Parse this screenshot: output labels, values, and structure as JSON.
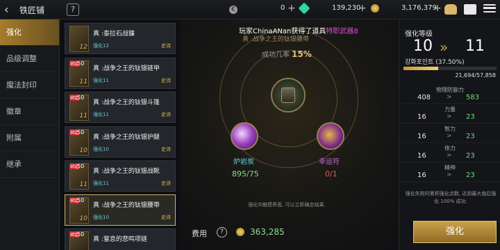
{
  "header": {
    "title": "铁匠铺",
    "help": "?",
    "currencies": [
      {
        "icon": "euro-coin-icon",
        "value": "0",
        "color": "#c8c8c8"
      },
      {
        "icon": "green-gem-icon",
        "value": "139,230",
        "color": "#2fd6a0"
      },
      {
        "icon": "gold-coin-icon",
        "value": "3,176,379",
        "color": "#e2b640"
      }
    ],
    "plus": "+"
  },
  "tabs": [
    {
      "label": "强化",
      "active": true
    },
    {
      "label": "品级调整"
    },
    {
      "label": "魔法封印"
    },
    {
      "label": "徽章"
    },
    {
      "label": "附属"
    },
    {
      "label": "继承"
    }
  ],
  "items": [
    {
      "name": "真 :泰拉石战镰",
      "level": "强化12",
      "grade": "史诗",
      "tag": "",
      "count": "",
      "plus": "12"
    },
    {
      "name": "真 :战争之王的钛银链甲",
      "level": "强化11",
      "grade": "史诗",
      "tag": "绑定",
      "count": "50",
      "plus": "11"
    },
    {
      "name": "真 :战争之王的钛银斗篷",
      "level": "强化11",
      "grade": "史诗",
      "tag": "绑定",
      "count": "50",
      "plus": "11"
    },
    {
      "name": "真 :战争之王的钛银护腿",
      "level": "强化10",
      "grade": "史诗",
      "tag": "绑定",
      "count": "50",
      "plus": "10"
    },
    {
      "name": "真 :战争之王的钛银战靴",
      "level": "强化11",
      "grade": "史诗",
      "tag": "绑定",
      "count": "50",
      "plus": "11"
    },
    {
      "name": "真 :战争之王的钛银腰带",
      "level": "强化10",
      "grade": "史诗",
      "tag": "绑定",
      "count": "50",
      "plus": "10",
      "selected": true
    },
    {
      "name": "真 :窒息的悲鸣项链",
      "level": "",
      "grade": "",
      "tag": "绑定",
      "count": "50",
      "plus": ""
    }
  ],
  "center": {
    "notice_prefix": "玩家ChinaANan获得了道具",
    "notice_item": "特职武器8",
    "subtitle": "真 :战争之王的钛银腰带",
    "rate_label": "成功几率",
    "rate_value": "15%",
    "materials": [
      {
        "name": "炉岩炭",
        "count": "895/75"
      },
      {
        "name": "幸运符",
        "count": "0/1"
      }
    ],
    "hint": "强化中触摸界面, 可以立即确定结果.",
    "cost_label": "费用",
    "cost_help": "?",
    "cost_value": "363,285"
  },
  "panel": {
    "title": "强化等级",
    "from": "10",
    "arrow": "»",
    "to": "11",
    "points_label": "강화포인트 (37.50%)",
    "points_value": "21,694/57,858",
    "points_fraction": 0.375,
    "stats": [
      {
        "name": "物理防御力",
        "old": "408",
        "new": "583"
      },
      {
        "name": "力量",
        "old": "16",
        "new": "23"
      },
      {
        "name": "智力",
        "old": "16",
        "new": "23"
      },
      {
        "name": "体力",
        "old": "16",
        "new": "23"
      },
      {
        "name": "精神",
        "old": "16",
        "new": "23"
      }
    ],
    "stat_arrow": ">",
    "note": "强化失败时累积强化点数, 达到最大值后强化 100% 成功.",
    "button": "强化"
  }
}
